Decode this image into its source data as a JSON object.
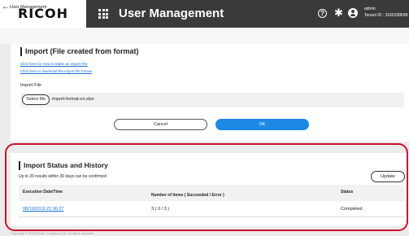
{
  "header": {
    "brand": "RICOH",
    "app_title": "User Management",
    "user_name": "admin",
    "tenant_id": "Tenant ID : 3165338699",
    "icons": [
      "apps-grid-icon",
      "help-icon",
      "gear-icon",
      "user-icon"
    ]
  },
  "nav": {
    "back_label": "User Management"
  },
  "import_section": {
    "title": "Import (File created from format)",
    "link_howto": "Click here for How to Make an Import File",
    "link_download": "Click here to download the import file format",
    "import_file_label": "Import File",
    "select_file_label": "Select file",
    "selected_file": "import-format-en.xlsx",
    "cancel_label": "Cancel",
    "ok_label": "OK"
  },
  "history_section": {
    "title": "Import Status and History",
    "note": "Up to 20 results within 30 days can be confirmed",
    "update_label": "Update",
    "columns": [
      "Execution Date/Time",
      "Number of Items ( Succeeded / Error )",
      "Status"
    ],
    "rows": [
      {
        "date": "08/19/2019 21:06:27",
        "items": "3 ( 0 / 3 )",
        "status": "Completed"
      }
    ]
  },
  "footer": {
    "text": "Copyright © 2019 Ricoh Company, Ltd. All rights reserved."
  },
  "colors": {
    "topbar": "#3a3a3a",
    "accent": "#1e88e5",
    "highlight": "#c8102e",
    "link": "#1a6fd6"
  }
}
